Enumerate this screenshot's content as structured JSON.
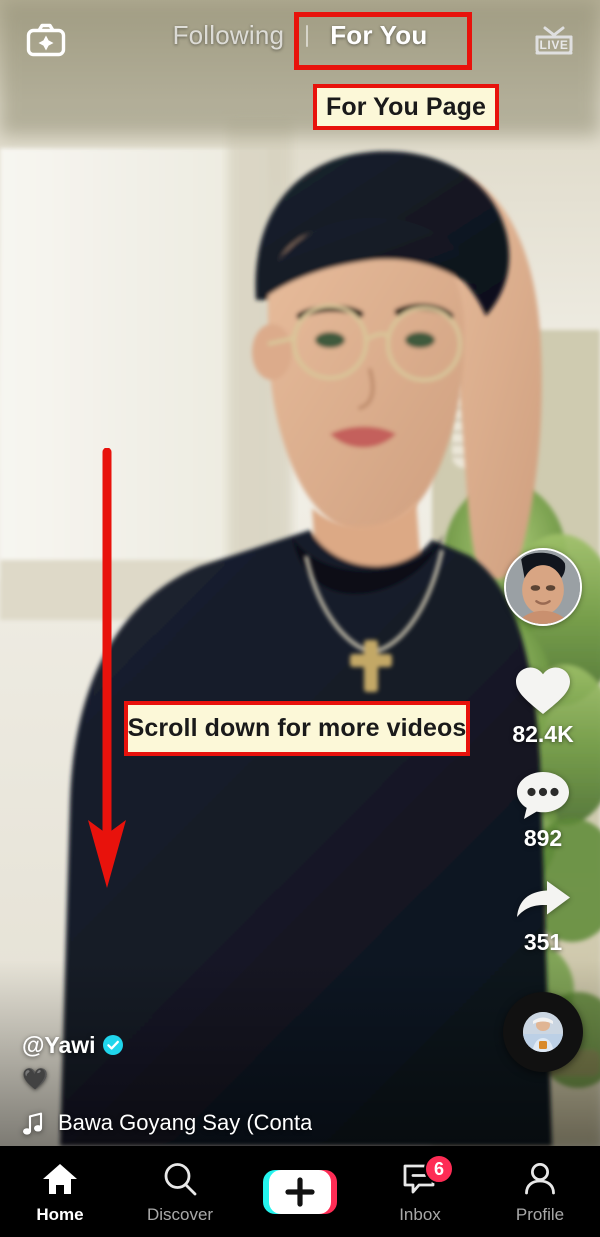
{
  "app": {
    "name": "TikTok",
    "screen": "For You feed"
  },
  "topbar": {
    "effects_icon": "camera-sparkle-icon",
    "tabs": [
      {
        "label": "Following",
        "active": false
      },
      {
        "label": "For You",
        "active": true
      }
    ],
    "live_icon": "live-tv-icon",
    "live_label": "LIVE"
  },
  "rail": {
    "avatar_icon": "creator-avatar",
    "actions": [
      {
        "icon": "heart-icon",
        "name": "like",
        "count": "82.4K"
      },
      {
        "icon": "comment-icon",
        "name": "comment",
        "count": "892"
      },
      {
        "icon": "share-arrow-icon",
        "name": "share",
        "count": "351"
      }
    ],
    "music_disc_icon": "spinning-music-disc"
  },
  "caption": {
    "handle": "@Yawi",
    "verified_icon": "verified-badge-icon",
    "description": "🖤",
    "music_note_icon": "music-note-icon",
    "music_title": "Bawa Goyang Say (Conta"
  },
  "navbar": {
    "items": [
      {
        "label": "Home",
        "icon": "home-icon",
        "active": true,
        "badge": ""
      },
      {
        "label": "Discover",
        "icon": "search-icon",
        "active": false,
        "badge": ""
      },
      {
        "label": "",
        "icon": "create-plus-icon",
        "active": false,
        "badge": ""
      },
      {
        "label": "Inbox",
        "icon": "inbox-icon",
        "active": false,
        "badge": "6"
      },
      {
        "label": "Profile",
        "icon": "person-icon",
        "active": false,
        "badge": ""
      }
    ]
  },
  "annotations": [
    {
      "type": "highlight-box",
      "target": "for-you-tab"
    },
    {
      "type": "callout",
      "text": "For You Page"
    },
    {
      "type": "callout",
      "text": "Scroll down for more videos"
    },
    {
      "type": "arrow",
      "direction": "down",
      "name": "scroll-down-arrow"
    }
  ],
  "colors": {
    "annotation_red": "#e8120c",
    "callout_fill": "#fcf8d8",
    "tiktok_pink": "#fe2c55",
    "tiktok_cyan": "#25f4ee",
    "nav_background": "#000000",
    "verified_blue": "#20d5ec"
  }
}
